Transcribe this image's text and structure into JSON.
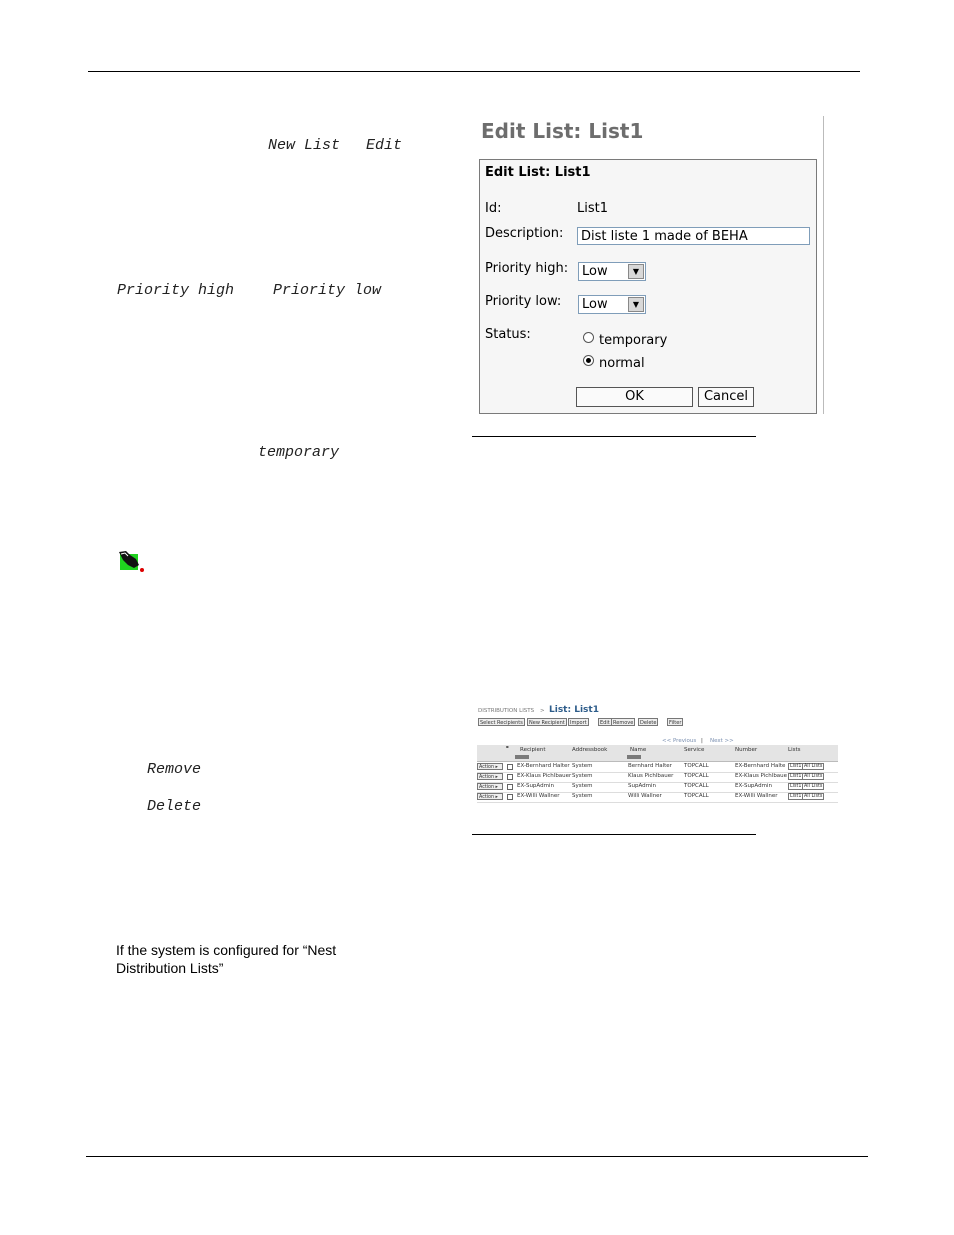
{
  "doc": {
    "inline_new_list": "New List",
    "inline_edit": "Edit",
    "inline_priority_high": "Priority high",
    "inline_priority_low": "Priority low",
    "inline_temporary": "temporary",
    "inline_remove": "Remove",
    "inline_delete": "Delete",
    "nest_line1": "If the system is configured for “Nest",
    "nest_line2": "Distribution Lists”"
  },
  "edit_dialog": {
    "heading": "Edit List: List1",
    "box_title": "Edit List: List1",
    "id_label": "Id:",
    "id_value": "List1",
    "description_label": "Description:",
    "description_value": "Dist liste 1 made of BEHA",
    "priority_high_label": "Priority high:",
    "priority_high_value": "Low",
    "priority_low_label": "Priority low:",
    "priority_low_value": "Low",
    "status_label": "Status:",
    "status_options": [
      "temporary",
      "normal"
    ],
    "status_selected": "normal",
    "ok_label": "OK",
    "cancel_label": "Cancel"
  },
  "dist_list": {
    "breadcrumb": "DISTRIBUTION LISTS",
    "separator": ">",
    "title": "List: List1",
    "toolbar": [
      "Select Recipients",
      "New Recipient",
      "Import",
      "Edit",
      "Remove",
      "Delete",
      "Filter"
    ],
    "pager_prev": "<< Previous",
    "pager_sep": "|",
    "pager_next": "Next >>",
    "columns": [
      "Recipient",
      "Addressbook",
      "Name",
      "Service",
      "Number",
      "Lists"
    ],
    "action_label": "Action",
    "rows": [
      {
        "recipient": "EX-Bernhard Halter",
        "addressbook": "System",
        "name": "Bernhard Halter",
        "service": "TOPCALL",
        "number": "EX-Bernhard Halte",
        "list": "List1",
        "all": "All Lists"
      },
      {
        "recipient": "EX-Klaus Pichlbauer",
        "addressbook": "System",
        "name": "Klaus Pichlbauer",
        "service": "TOPCALL",
        "number": "EX-Klaus Pichlbaue",
        "list": "List1",
        "all": "All Lists"
      },
      {
        "recipient": "EX-SupAdmin",
        "addressbook": "System",
        "name": "SupAdmin",
        "service": "TOPCALL",
        "number": "EX-SupAdmin",
        "list": "List1",
        "all": "All Lists"
      },
      {
        "recipient": "EX-Willi Wallner",
        "addressbook": "System",
        "name": "Willi Wallner",
        "service": "TOPCALL",
        "number": "EX-Willi Wallner",
        "list": "List1",
        "all": "All Lists"
      }
    ]
  }
}
